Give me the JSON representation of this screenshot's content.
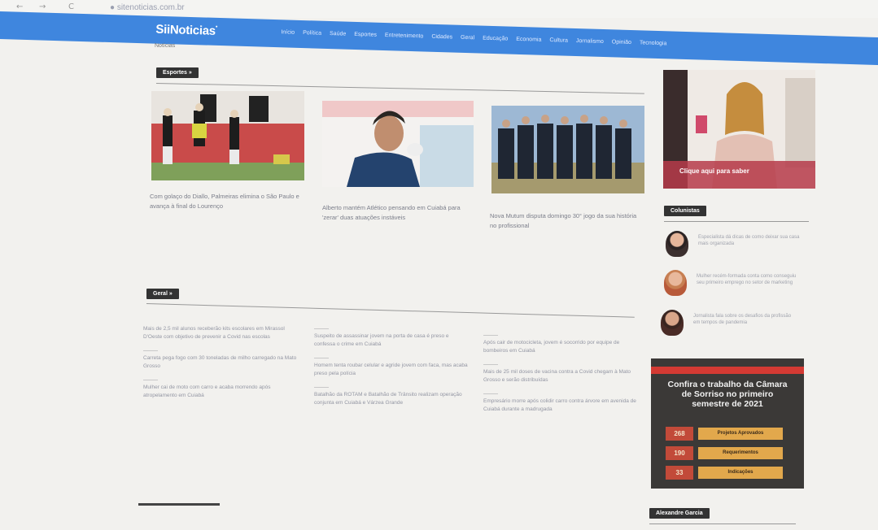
{
  "browser": {
    "back_glyph": "←",
    "forward_glyph": "→",
    "reload_glyph": "C",
    "url": "● sitenoticias.com.br"
  },
  "header": {
    "logo_text": "SiiNoticias",
    "logo_sup": "•",
    "subtitle": "Notícias",
    "menu": [
      "Início",
      "Política",
      "Saúde",
      "Esportes",
      "Entretenimento",
      "Cidades",
      "Geral",
      "Educação",
      "Economia",
      "Cultura",
      "Jornalismo",
      "Opinião",
      "Tecnologia"
    ]
  },
  "esportes": {
    "label": "Esportes  »",
    "cards": [
      {
        "text": "Com golaço do Diallo, Palmeiras elimina o São Paulo e avança à final do Lourenço"
      },
      {
        "text": "Alberto mantém Atlético pensando em Cuiabá para 'zerar' duas atuações instáveis"
      },
      {
        "text": "Nova Mutum disputa domingo 30° jogo da sua história no profissional"
      }
    ]
  },
  "geral": {
    "label": "Geral  »",
    "columns": [
      [
        "Mais de 2,5 mil alunos receberão kits escolares em Mirassol D'Oeste com objetivo de prevenir a Covid nas escolas",
        "Carreta pega fogo com 30 toneladas de milho carregado na Mato Grosso",
        "Mulher cai de moto com carro e acaba morrendo após atropelamento em Cuiabá"
      ],
      [
        "Suspeito de assassinar jovem na porta de casa é preso e confessa o crime em Cuiabá",
        "Homem tenta roubar celular e agride jovem com faca, mas acaba preso pela polícia",
        "Batalhão da ROTAM e Batalhão de Trânsito realizam operação conjunta em Cuiabá e Várzea Grande"
      ],
      [
        "Após cair de motocicleta, jovem é socorrido por equipe de bombeiros em Cuiabá",
        "Mais de 25 mil doses de vacina contra a Covid chegam à Mato Grosso e serão distribuídas",
        "Empresário morre após colidir carro contra árvore em avenida de Cuiabá durante a madrugada"
      ]
    ]
  },
  "sidebar": {
    "ad_caption": "Clique aqui para saber",
    "colunistas_label": "Colunistas",
    "colunistas": [
      {
        "text": "Especialista dá dicas de como deixar sua casa mais organizada"
      },
      {
        "text": "Mulher recém-formada conta como conseguiu seu primeiro emprego no setor de marketing"
      },
      {
        "text": "Jornalista fala sobre os desafios da profissão em tempos de pandemia"
      }
    ],
    "promo": {
      "title": "Confira o trabalho da Câmara de Sorriso no primeiro semestre de 2021",
      "rows": [
        {
          "num": "268",
          "label": "Projetos Aprovados"
        },
        {
          "num": "190",
          "label": "Requerimentos"
        },
        {
          "num": "33",
          "label": "Indicações"
        }
      ]
    },
    "bottom_label": "Alexandre Garcia"
  }
}
